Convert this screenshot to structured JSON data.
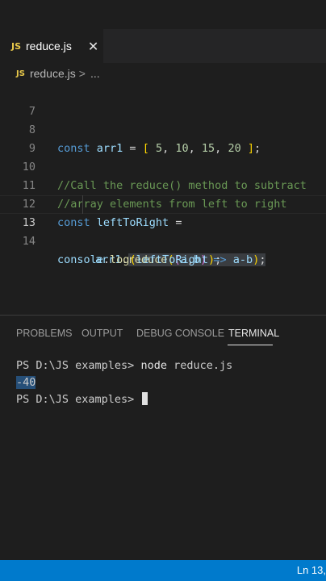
{
  "tab": {
    "badge": "JS",
    "filename": "reduce.js",
    "close_glyph": "✕"
  },
  "breadcrumb": {
    "badge": "JS",
    "file": "reduce.js",
    "chevron": ">",
    "more": "..."
  },
  "editor": {
    "line_numbers": [
      "7",
      "8",
      "9",
      "10",
      "11",
      "12",
      "13",
      "14"
    ],
    "lines": {
      "l8": {
        "kw": "const",
        "var": "arr1",
        "eq": " = ",
        "open": "[",
        "n1": "5",
        "n2": "10",
        "n3": "15",
        "n4": "20",
        "close": "]",
        "end": ";"
      },
      "l10": "//Call the reduce() method to subtract",
      "l11": "//array elements from left to right",
      "l12": {
        "kw": "const",
        "var": "leftToRight",
        "eq": " ="
      },
      "l13": {
        "obj": "arr1",
        "dot": ".",
        "fn": "reduce",
        "p1": "(",
        "p2": "(",
        "a": "a",
        "comma": ",",
        "b": "b",
        "p3": ")",
        "arrow": " => ",
        "expr": "a-b",
        "p4": ")",
        "end": ";"
      },
      "l14": {
        "obj": "console",
        "dot": ".",
        "fn": "log",
        "p1": "(",
        "arg": "leftToRight",
        "p2": ")",
        "end": ";"
      }
    }
  },
  "panel": {
    "tabs": [
      "PROBLEMS",
      "OUTPUT",
      "DEBUG CONSOLE",
      "TERMINAL"
    ],
    "active_tab": "TERMINAL",
    "terminal": {
      "prompt": "PS D:\\JS examples>",
      "cmd_keyword": "node",
      "cmd_arg": "reduce.js",
      "output": "-40",
      "prompt2": "PS D:\\JS examples>"
    }
  },
  "status": {
    "position": "Ln 13,"
  },
  "colors": {
    "accent": "#007acc",
    "editor_bg": "#1e1e1e",
    "keyword": "#569cd6",
    "comment": "#6a9955"
  }
}
